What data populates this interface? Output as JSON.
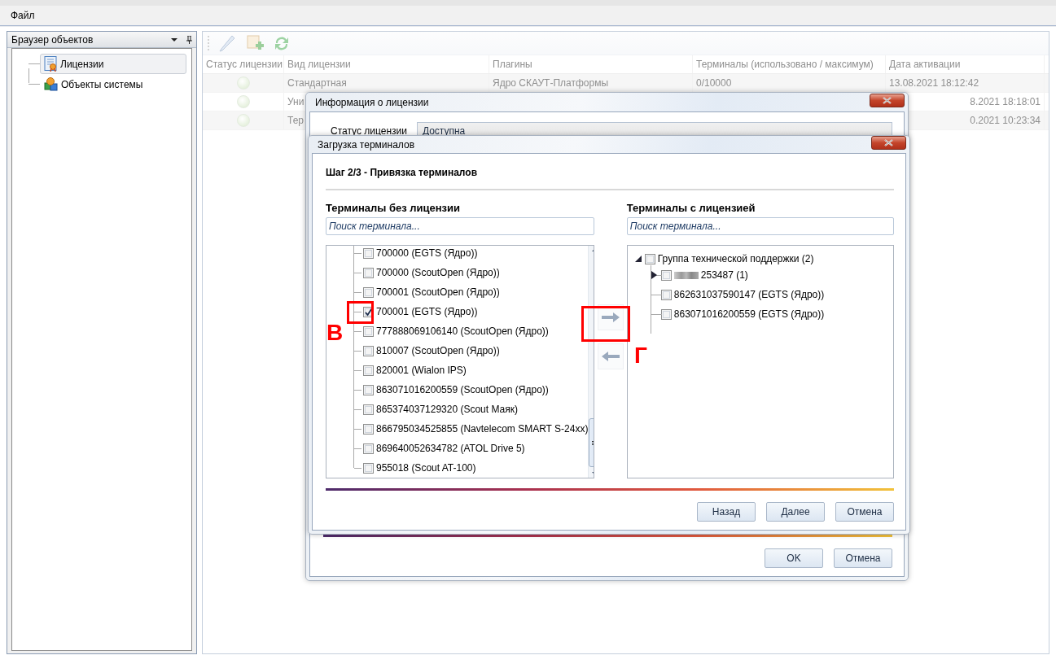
{
  "menu": [
    {
      "label": "Файл"
    }
  ],
  "object_browser": {
    "title": "Браузер объектов",
    "items": [
      {
        "label": "Лицензии",
        "selected": true
      },
      {
        "label": "Объекты системы",
        "selected": false
      }
    ]
  },
  "licenses_table": {
    "columns": [
      "Статус лицензии",
      "Вид лицензии",
      "Плагины",
      "Терминалы (использовано / максимум)",
      "Дата активации"
    ],
    "rows": [
      {
        "type": "Стандартная",
        "plugins": "Ядро СКАУТ-Платформы",
        "terminals": "0/10000",
        "activated": "13.08.2021 18:12:42"
      },
      {
        "type": "Уни",
        "activated": "8.2021 18:18:01"
      },
      {
        "type": "Тер",
        "activated": "0.2021 10:23:34"
      }
    ]
  },
  "license_dialog": {
    "title": "Информация о лицензии",
    "status_label": "Статус лицензии",
    "status_value": "Доступна",
    "buttons": [
      "OK",
      "Отмена"
    ]
  },
  "load_dialog": {
    "title": "Загрузка терминалов",
    "step": "Шаг 2/3 - Привязка терминалов",
    "left": {
      "heading": "Терминалы без лицензии",
      "placeholder": "Поиск терминала...",
      "items": [
        {
          "label": "700000 (EGTS (Ядро))",
          "checked": false
        },
        {
          "label": "700000 (ScoutOpen (Ядро))",
          "checked": false
        },
        {
          "label": "700001 (ScoutOpen (Ядро))",
          "checked": false
        },
        {
          "label": "700001 (EGTS (Ядро))",
          "checked": true
        },
        {
          "label": "777888069106140 (ScoutOpen (Ядро))",
          "checked": false
        },
        {
          "label": "810007 (ScoutOpen (Ядро))",
          "checked": false
        },
        {
          "label": "820001 (Wialon IPS)",
          "checked": false
        },
        {
          "label": "863071016200559 (ScoutOpen (Ядро))",
          "checked": false
        },
        {
          "label": "865374037129320 (Scout Маяк)",
          "checked": false
        },
        {
          "label": "866795034525855 (Navtelecom SMART S-24xx)",
          "checked": false
        },
        {
          "label": "869640052634782 (ATOL Drive 5)",
          "checked": false
        },
        {
          "label": "955018 (Scout AT-100)",
          "checked": false
        }
      ]
    },
    "right": {
      "heading": "Терминалы с лицензией",
      "placeholder": "Поиск терминала...",
      "tree": [
        {
          "label": "Группа технической поддержки (2)",
          "checked": false,
          "expanded": true,
          "children": [
            {
              "label": "253487 (1)",
              "checked": false,
              "expanded": false,
              "redacted": true
            },
            {
              "label": "862631037590147 (EGTS (Ядро))",
              "checked": false
            },
            {
              "label": "863071016200559 (EGTS (Ядро))",
              "checked": false
            }
          ]
        }
      ]
    },
    "buttons": [
      "Назад",
      "Далее",
      "Отмена"
    ]
  },
  "annotations": [
    {
      "label": "В"
    },
    {
      "label": "Г"
    }
  ]
}
